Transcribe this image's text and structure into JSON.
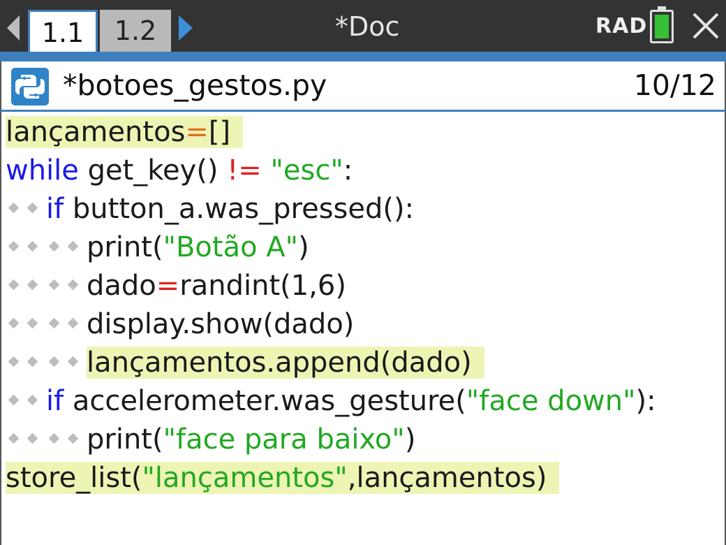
{
  "topbar": {
    "tabs": [
      {
        "label": "1.1",
        "active": true
      },
      {
        "label": "1.2",
        "active": false
      }
    ],
    "doc_title": "*Doc",
    "angle_mode": "RAD",
    "battery_icon": "battery-icon",
    "close_icon": "close-icon"
  },
  "editor": {
    "icon": "python-icon",
    "filename": "*botoes_gestos.py",
    "line_position": "10/12"
  },
  "code": {
    "l1": {
      "a": "lançamentos",
      "b": "=",
      "c": "[]"
    },
    "l2": {
      "kw": "while",
      "a": " get_key() ",
      "op": "!=",
      "sp": " ",
      "str": "\"esc\"",
      "end": ":"
    },
    "l3": {
      "kw": "if",
      "a": " button_a.was_pressed():"
    },
    "l4": {
      "a": "print(",
      "str": "\"Botão A\"",
      "end": ")"
    },
    "l5": {
      "a": "dado",
      "op": "=",
      "b": "randint(1,6)"
    },
    "l6": {
      "a": "display.show(dado)"
    },
    "l7": {
      "a": "lançamentos.append(dado)"
    },
    "l8": {
      "kw": "if",
      "a": " accelerometer.was_gesture(",
      "str": "\"face down\"",
      "end": "):"
    },
    "l9": {
      "a": "print(",
      "str": "\"face para baixo\"",
      "end": ")"
    },
    "l10": {
      "a": "store_list(",
      "str": "\"lançamentos\"",
      "end": ",lançamentos)"
    }
  },
  "colors": {
    "accent": "#3d7fbd",
    "highlight": "#eef4b4",
    "keyword": "#1a1ae8",
    "string": "#22a822",
    "operator": "#e02020"
  }
}
